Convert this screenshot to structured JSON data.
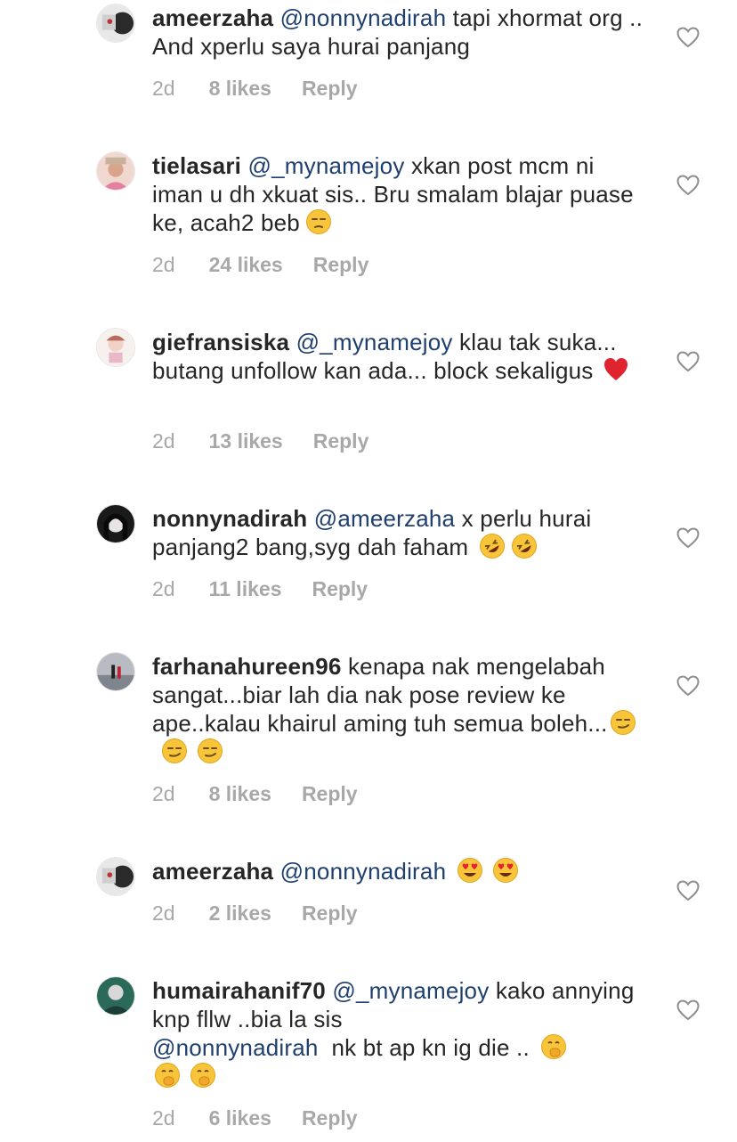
{
  "comments": [
    {
      "username": "ameerzaha",
      "mention": "@nonnynadirah",
      "text": "tapi xhormat org .. And xperlu saya hurai panjang",
      "time": "2d",
      "likes": "8 likes",
      "reply": "Reply"
    },
    {
      "username": "tielasari",
      "mention": "@_mynamejoy",
      "text": "xkan post mcm ni iman u dh xkuat sis.. Bru smalam blajar puase ke, acah2 beb",
      "emoji": "unamused-face-icon",
      "time": "2d",
      "likes": "24 likes",
      "reply": "Reply"
    },
    {
      "username": "giefransiska",
      "mention": "@_mynamejoy",
      "text": "klau tak suka... butang unfollow kan ada... block sekaligus",
      "emoji": "red-heart-icon",
      "time": "2d",
      "likes": "13 likes",
      "reply": "Reply"
    },
    {
      "username": "nonnynadirah",
      "mention": "@ameerzaha",
      "text": "x perlu hurai panjang2 bang,syg dah faham",
      "emoji": "rofl-face-icon",
      "time": "2d",
      "likes": "11 likes",
      "reply": "Reply"
    },
    {
      "username": "farhanahureen96",
      "text": "kenapa nak mengelabah sangat...biar lah dia nak pose review ke ape..kalau khairul aming tuh semua boleh...",
      "emoji": "smirk-face-icon",
      "time": "2d",
      "likes": "8 likes",
      "reply": "Reply"
    },
    {
      "username": "ameerzaha",
      "mention": "@nonnynadirah",
      "emoji": "heart-eyes-face-icon",
      "time": "2d",
      "likes": "2 likes",
      "reply": "Reply"
    },
    {
      "username": "humairahanif70",
      "mention": "@_mynamejoy",
      "text": "kako annying knp fllw ..bia la sis",
      "mention2": "@nonnynadirah",
      "text2": "nk bt ap kn ig die ..",
      "emoji": "hand-over-mouth-face-icon",
      "time": "2d",
      "likes": "6 likes",
      "reply": "Reply"
    }
  ],
  "colors": {
    "mention": "#1f3f6f",
    "meta": "#a8a8a8",
    "heart_outline": "#8e8e8e"
  }
}
